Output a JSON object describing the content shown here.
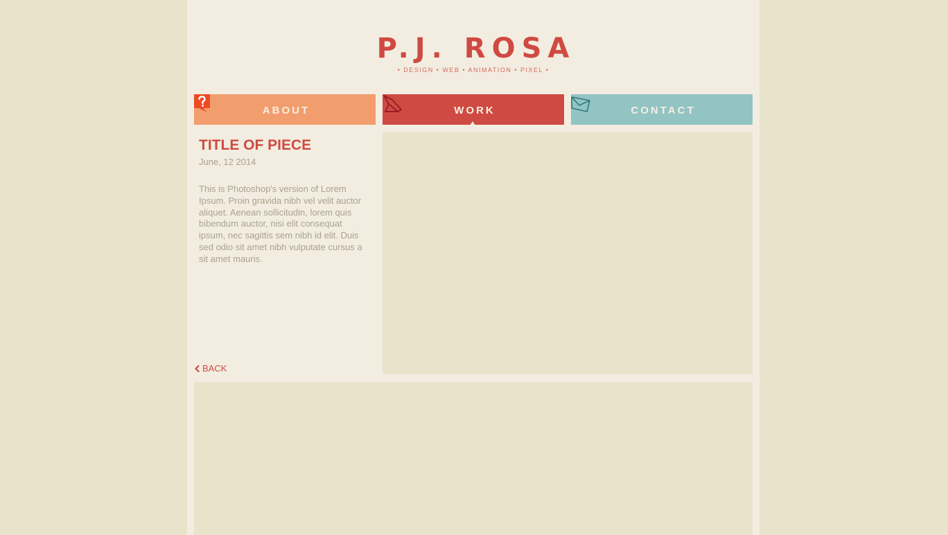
{
  "brand": {
    "logo": "P.J. ROSA",
    "tagline": "• DESIGN • WEB • ANIMATION • PIXEL •"
  },
  "nav": {
    "tabs": [
      {
        "label": "ABOUT",
        "icon": "question-bubble-icon",
        "color": "#f29d6e"
      },
      {
        "label": "WORK",
        "icon": "pencil-icon",
        "color": "#cf4a42",
        "active": true
      },
      {
        "label": "CONTACT",
        "icon": "envelope-icon",
        "color": "#92c4c3"
      }
    ]
  },
  "piece": {
    "title": "TITLE OF PIECE",
    "date": "June, 12 2014",
    "description": "This is Photoshop's version  of Lorem Ipsum. Proin gravida nibh vel velit auctor aliquet. Aenean sollicitudin, lorem quis bibendum auctor, nisi elit consequat ipsum, nec sagittis sem nibh id elit. Duis sed odio sit amet nibh vulputate cursus a sit amet mauris.",
    "back_label": "BACK"
  },
  "colors": {
    "accent": "#cf4a42",
    "background": "#e9e3cc",
    "page": "#f2ede0",
    "muted_text": "#aaa28f"
  }
}
